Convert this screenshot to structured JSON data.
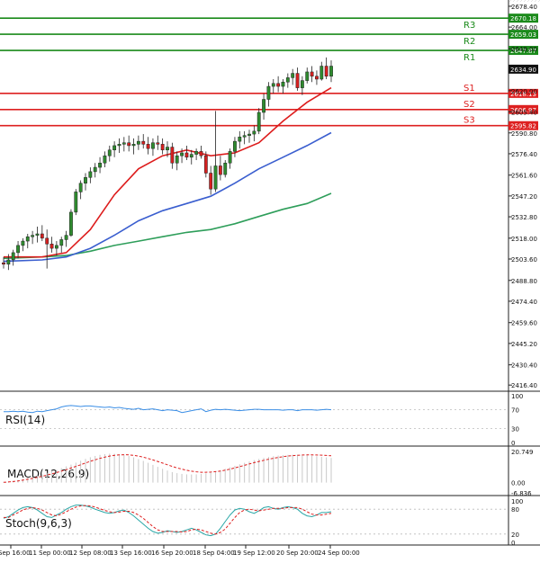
{
  "chart_data": {
    "type": "candlestick",
    "colors": {
      "up": "#2e8b2e",
      "down": "#d62020",
      "resistance": "#1a8a1a",
      "support": "#dd2020",
      "ma_fast": "#dd1c1c",
      "ma_mid": "#3a5ecf",
      "ma_slow": "#2e9e5a",
      "rsi": "#3a8ee6",
      "macd_hist": "#c8c8c8",
      "macd_signal": "#dd1c1c",
      "stoch_k": "#2aa7a7",
      "stoch_d": "#dd1c1c"
    },
    "main": {
      "ylim": [
        2413.4,
        2679.0
      ],
      "yticks": [
        "2678.40",
        "2664.00",
        "2649.00",
        "2634.90",
        "2620.00",
        "2605.40",
        "2590.80",
        "2576.40",
        "2561.60",
        "2547.20",
        "2532.80",
        "2518.00",
        "2503.60",
        "2488.80",
        "2474.40",
        "2459.60",
        "2445.20",
        "2430.40",
        "2416.40"
      ],
      "levels": [
        {
          "label": "R3",
          "value": 2670.18,
          "kind": "resistance",
          "text": "2670.18"
        },
        {
          "label": "R2",
          "value": 2659.03,
          "kind": "resistance",
          "text": "2659.03"
        },
        {
          "label": "R1",
          "value": 2647.87,
          "kind": "resistance",
          "text": "2647.87"
        },
        {
          "label": "S1",
          "value": 2618.13,
          "kind": "support",
          "text": "2618.13"
        },
        {
          "label": "S2",
          "value": 2606.97,
          "kind": "support",
          "text": "2606.97"
        },
        {
          "label": "S3",
          "value": 2595.82,
          "kind": "support",
          "text": "2595.82"
        }
      ],
      "current_price": "2634.90",
      "ohlc": [
        [
          2501,
          2505,
          2497,
          2500
        ],
        [
          2500,
          2507,
          2496,
          2503
        ],
        [
          2503,
          2510,
          2499,
          2508
        ],
        [
          2508,
          2516,
          2504,
          2513
        ],
        [
          2513,
          2518,
          2509,
          2516
        ],
        [
          2516,
          2521,
          2511,
          2519
        ],
        [
          2519,
          2523,
          2514,
          2520
        ],
        [
          2520,
          2526,
          2515,
          2521
        ],
        [
          2521,
          2527,
          2516,
          2518
        ],
        [
          2518,
          2524,
          2497,
          2514
        ],
        [
          2514,
          2519,
          2508,
          2511
        ],
        [
          2511,
          2516,
          2506,
          2513
        ],
        [
          2513,
          2519,
          2508,
          2517
        ],
        [
          2517,
          2523,
          2512,
          2520
        ],
        [
          2520,
          2538,
          2519,
          2536
        ],
        [
          2536,
          2552,
          2534,
          2550
        ],
        [
          2550,
          2558,
          2545,
          2556
        ],
        [
          2556,
          2563,
          2551,
          2560
        ],
        [
          2560,
          2567,
          2556,
          2564
        ],
        [
          2564,
          2570,
          2560,
          2567
        ],
        [
          2567,
          2574,
          2563,
          2570
        ],
        [
          2570,
          2578,
          2567,
          2575
        ],
        [
          2575,
          2582,
          2571,
          2579
        ],
        [
          2579,
          2585,
          2574,
          2582
        ],
        [
          2582,
          2587,
          2577,
          2583
        ],
        [
          2583,
          2588,
          2578,
          2584
        ],
        [
          2584,
          2589,
          2578,
          2582
        ],
        [
          2582,
          2587,
          2576,
          2583
        ],
        [
          2583,
          2589,
          2579,
          2585
        ],
        [
          2585,
          2590,
          2580,
          2583
        ],
        [
          2583,
          2588,
          2576,
          2580
        ],
        [
          2580,
          2587,
          2575,
          2584
        ],
        [
          2584,
          2589,
          2579,
          2583
        ],
        [
          2583,
          2587,
          2576,
          2579
        ],
        [
          2579,
          2585,
          2574,
          2581
        ],
        [
          2581,
          2584,
          2566,
          2570
        ],
        [
          2570,
          2578,
          2565,
          2575
        ],
        [
          2575,
          2580,
          2570,
          2577
        ],
        [
          2577,
          2582,
          2572,
          2574
        ],
        [
          2574,
          2579,
          2569,
          2576
        ],
        [
          2576,
          2580,
          2572,
          2578
        ],
        [
          2578,
          2582,
          2573,
          2575
        ],
        [
          2575,
          2578,
          2560,
          2563
        ],
        [
          2563,
          2568,
          2548,
          2552
        ],
        [
          2552,
          2606,
          2550,
          2568
        ],
        [
          2568,
          2575,
          2558,
          2562
        ],
        [
          2562,
          2572,
          2560,
          2570
        ],
        [
          2570,
          2580,
          2566,
          2578
        ],
        [
          2578,
          2588,
          2574,
          2585
        ],
        [
          2585,
          2592,
          2580,
          2588
        ],
        [
          2588,
          2592,
          2583,
          2589
        ],
        [
          2589,
          2593,
          2584,
          2590
        ],
        [
          2590,
          2596,
          2585,
          2592
        ],
        [
          2592,
          2608,
          2590,
          2605
        ],
        [
          2605,
          2618,
          2600,
          2614
        ],
        [
          2614,
          2626,
          2609,
          2623
        ],
        [
          2623,
          2628,
          2618,
          2625
        ],
        [
          2625,
          2630,
          2619,
          2623
        ],
        [
          2623,
          2628,
          2618,
          2626
        ],
        [
          2626,
          2632,
          2622,
          2629
        ],
        [
          2629,
          2635,
          2624,
          2632
        ],
        [
          2632,
          2636,
          2620,
          2622
        ],
        [
          2622,
          2630,
          2617,
          2627
        ],
        [
          2627,
          2636,
          2625,
          2633
        ],
        [
          2633,
          2637,
          2626,
          2630
        ],
        [
          2630,
          2634,
          2624,
          2628
        ],
        [
          2628,
          2640,
          2627,
          2637
        ],
        [
          2637,
          2643,
          2628,
          2630
        ],
        [
          2630,
          2641,
          2626,
          2637
        ]
      ],
      "ma_fast": [
        [
          0,
          2505
        ],
        [
          8,
          2505
        ],
        [
          13,
          2508
        ],
        [
          18,
          2524
        ],
        [
          23,
          2548
        ],
        [
          28,
          2566
        ],
        [
          33,
          2575
        ],
        [
          38,
          2579
        ],
        [
          43,
          2575
        ],
        [
          48,
          2577
        ],
        [
          53,
          2584
        ],
        [
          58,
          2599
        ],
        [
          63,
          2612
        ],
        [
          68,
          2622
        ]
      ],
      "ma_mid": [
        [
          0,
          2502
        ],
        [
          8,
          2503
        ],
        [
          13,
          2505
        ],
        [
          18,
          2511
        ],
        [
          23,
          2520
        ],
        [
          28,
          2530
        ],
        [
          33,
          2537
        ],
        [
          38,
          2542
        ],
        [
          43,
          2547
        ],
        [
          48,
          2556
        ],
        [
          53,
          2566
        ],
        [
          58,
          2574
        ],
        [
          63,
          2582
        ],
        [
          68,
          2591
        ]
      ],
      "ma_slow": [
        [
          0,
          2504
        ],
        [
          8,
          2505
        ],
        [
          13,
          2506
        ],
        [
          18,
          2509
        ],
        [
          23,
          2513
        ],
        [
          28,
          2516
        ],
        [
          33,
          2519
        ],
        [
          38,
          2522
        ],
        [
          43,
          2524
        ],
        [
          48,
          2528
        ],
        [
          53,
          2533
        ],
        [
          58,
          2538
        ],
        [
          63,
          2542
        ],
        [
          68,
          2549
        ]
      ]
    },
    "rsi": {
      "name": "RSI(14)",
      "ticks": [
        "100",
        "70",
        "30",
        "0"
      ],
      "values": [
        66,
        66,
        67,
        66,
        67,
        65,
        64,
        67,
        66,
        68,
        70,
        72,
        76,
        78,
        79,
        78,
        77,
        78,
        78,
        77,
        76,
        75,
        76,
        74,
        75,
        73,
        72,
        71,
        73,
        70,
        71,
        72,
        70,
        68,
        70,
        69,
        68,
        64,
        66,
        68,
        70,
        72,
        66,
        69,
        71,
        70,
        71,
        70,
        69,
        68,
        69,
        70,
        71,
        71,
        70,
        70,
        70,
        70,
        69,
        70,
        70,
        68,
        70,
        70,
        70,
        69,
        70,
        71,
        70
      ]
    },
    "macd": {
      "name": "MACD(12,26,9)",
      "ticks": [
        "20.749",
        "0.00",
        "-6.836"
      ],
      "hist": [
        0.5,
        0.8,
        1.2,
        1.8,
        2.5,
        3.2,
        4.0,
        4.8,
        5.6,
        6.5,
        7.5,
        8.5,
        9.6,
        10.8,
        12.0,
        13.3,
        14.6,
        15.8,
        16.9,
        17.8,
        18.5,
        19.0,
        19.3,
        19.2,
        18.9,
        18.4,
        17.7,
        16.8,
        15.7,
        14.5,
        13.2,
        11.8,
        10.5,
        9.2,
        8.0,
        7.0,
        6.3,
        5.8,
        5.5,
        5.4,
        5.5,
        5.8,
        6.2,
        6.8,
        7.5,
        8.3,
        9.2,
        10.2,
        11.2,
        12.2,
        13.2,
        14.1,
        15.0,
        15.8,
        16.5,
        17.1,
        17.6,
        18.0,
        18.3,
        18.5,
        18.6,
        18.6,
        18.5,
        18.3,
        18.0,
        17.6,
        17.2,
        16.8,
        16.4
      ],
      "signal": [
        0.2,
        0.4,
        0.7,
        1.1,
        1.6,
        2.2,
        2.8,
        3.5,
        4.2,
        5.0,
        5.8,
        6.7,
        7.6,
        8.6,
        9.7,
        10.8,
        11.9,
        13.1,
        14.2,
        15.2,
        16.2,
        17.0,
        17.7,
        18.2,
        18.5,
        18.6,
        18.5,
        18.2,
        17.7,
        17.0,
        16.1,
        15.1,
        14.1,
        13.0,
        11.9,
        10.8,
        9.8,
        9.0,
        8.2,
        7.6,
        7.2,
        6.9,
        6.9,
        7.0,
        7.3,
        7.7,
        8.3,
        9.0,
        9.8,
        10.6,
        11.5,
        12.4,
        13.3,
        14.1,
        14.9,
        15.6,
        16.2,
        16.8,
        17.3,
        17.7,
        18.0,
        18.2,
        18.4,
        18.5,
        18.5,
        18.4,
        18.3,
        18.1,
        17.9
      ]
    },
    "stoch": {
      "name": "Stoch(9,6,3)",
      "ticks": [
        "100",
        "80",
        "20",
        "0"
      ],
      "k": [
        58,
        62,
        70,
        78,
        84,
        86,
        84,
        78,
        70,
        62,
        60,
        66,
        72,
        80,
        86,
        90,
        90,
        88,
        85,
        80,
        76,
        72,
        70,
        72,
        76,
        78,
        72,
        64,
        54,
        44,
        34,
        26,
        22,
        24,
        28,
        26,
        24,
        26,
        30,
        34,
        30,
        24,
        18,
        16,
        20,
        34,
        50,
        66,
        78,
        82,
        80,
        74,
        70,
        76,
        84,
        86,
        82,
        80,
        84,
        86,
        84,
        80,
        70,
        64,
        62,
        66,
        72,
        72,
        74
      ],
      "d": [
        60,
        60,
        66,
        72,
        78,
        82,
        84,
        82,
        78,
        72,
        66,
        64,
        68,
        74,
        80,
        85,
        88,
        89,
        88,
        85,
        81,
        77,
        74,
        72,
        73,
        75,
        75,
        72,
        66,
        58,
        48,
        38,
        30,
        26,
        26,
        26,
        26,
        25,
        26,
        30,
        32,
        30,
        26,
        22,
        20,
        24,
        32,
        46,
        60,
        72,
        78,
        80,
        78,
        76,
        78,
        80,
        82,
        82,
        82,
        84,
        84,
        84,
        80,
        74,
        68,
        66,
        66,
        68,
        70
      ]
    },
    "x_tick_labels": [
      "Sep 16:00",
      "11 Sep 00:00",
      "12 Sep 08:00",
      "13 Sep 16:00",
      "16 Sep 20:00",
      "18 Sep 04:00",
      "19 Sep 12:00",
      "20 Sep 20:00",
      "24 Sep 00:00"
    ]
  }
}
